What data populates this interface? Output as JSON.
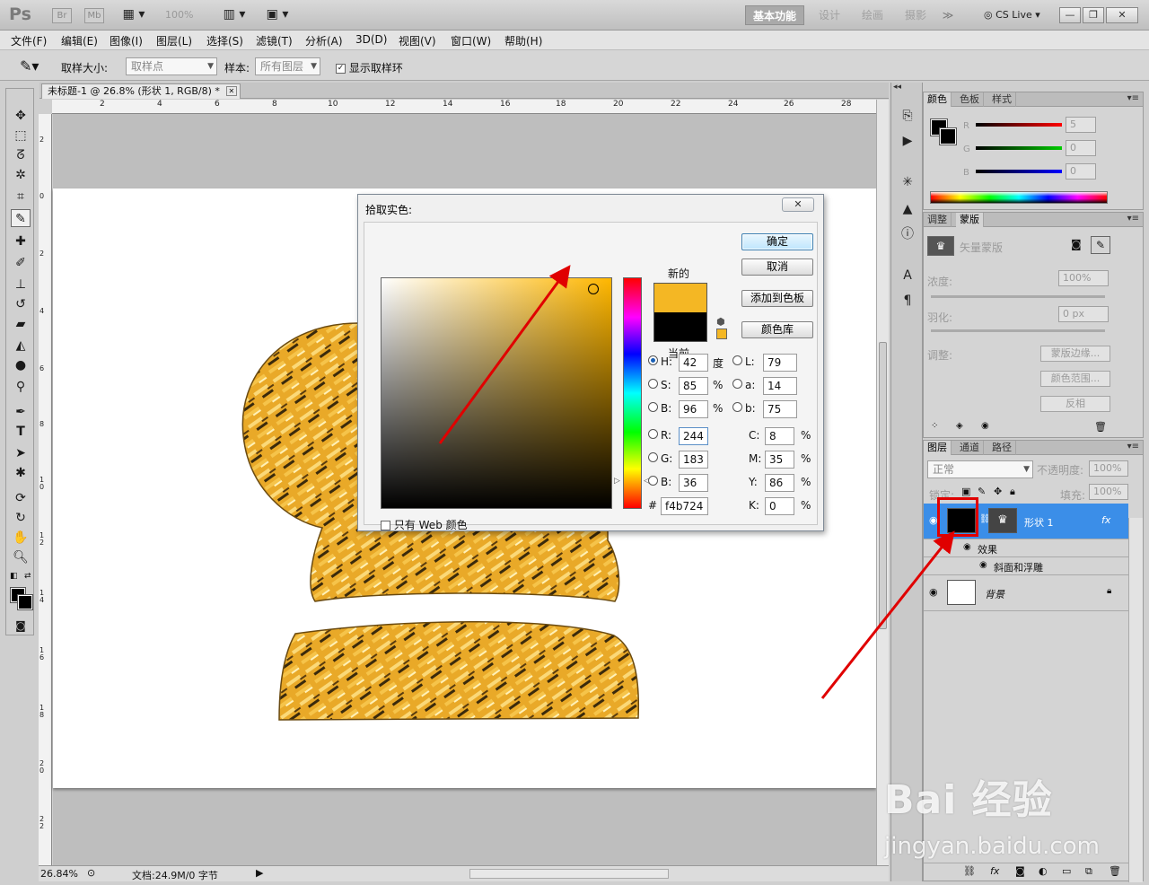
{
  "app": {
    "logo": "Ps",
    "bridge": "Br",
    "minibridge": "Mb",
    "zoom": "100%",
    "workspaces": [
      "基本功能",
      "设计",
      "绘画",
      "摄影"
    ],
    "more": "≫",
    "cslive": "CS Live",
    "window_buttons": [
      "—",
      "❐",
      "✕"
    ]
  },
  "menu": [
    "文件(F)",
    "编辑(E)",
    "图像(I)",
    "图层(L)",
    "选择(S)",
    "滤镜(T)",
    "分析(A)",
    "3D(D)",
    "视图(V)",
    "窗口(W)",
    "帮助(H)"
  ],
  "options": {
    "sample_size_label": "取样大小:",
    "sample_size_value": "取样点",
    "sample_label": "样本:",
    "sample_value": "所有图层",
    "show_ring_label": "显示取样环",
    "show_ring_checked": "✓"
  },
  "document": {
    "tab_title": "未标题-1 @ 26.8% (形状 1, RGB/8) *",
    "ruler_top": [
      "2",
      "4",
      "6",
      "8",
      "10",
      "12",
      "14",
      "16",
      "18",
      "20",
      "22",
      "24",
      "26",
      "28"
    ],
    "ruler_left": [
      "2",
      "0",
      "2",
      "4",
      "6",
      "8",
      "10",
      "12",
      "14",
      "16",
      "18",
      "20",
      "22"
    ],
    "zoom": "26.84%",
    "doc_info": "文档:24.9M/0 字节"
  },
  "picker": {
    "title": "拾取实色:",
    "close": "✕",
    "new_label": "新的",
    "current_label": "当前",
    "new_color": "#f4b724",
    "current_color": "#000000",
    "buttons": {
      "ok": "确定",
      "cancel": "取消",
      "add": "添加到色板",
      "library": "颜色库"
    },
    "hsb": {
      "h_label": "H:",
      "h": "42",
      "h_unit": "度",
      "s_label": "S:",
      "s": "85",
      "s_unit": "%",
      "b_label": "B:",
      "b": "96",
      "b_unit": "%"
    },
    "lab": {
      "l_label": "L:",
      "l": "79",
      "a_label": "a:",
      "a": "14",
      "b_label": "b:",
      "b": "75"
    },
    "rgb": {
      "r_label": "R:",
      "r": "244",
      "g_label": "G:",
      "g": "183",
      "b_label": "B:",
      "b": "36"
    },
    "cmyk": {
      "c_label": "C:",
      "c": "8",
      "m_label": "M:",
      "m": "35",
      "y_label": "Y:",
      "y": "86",
      "k_label": "K:",
      "k": "0",
      "unit": "%"
    },
    "hex_label": "#",
    "hex": "f4b724",
    "web_only": "只有 Web 颜色"
  },
  "color_panel": {
    "tabs": [
      "颜色",
      "色板",
      "样式"
    ],
    "r_label": "R",
    "g_label": "G",
    "b_label": "B",
    "r": "5",
    "g": "0",
    "b": "0"
  },
  "mask_panel": {
    "tabs": [
      "调整",
      "蒙版"
    ],
    "vector_mask": "矢量蒙版",
    "density_label": "浓度:",
    "density": "100%",
    "feather_label": "羽化:",
    "feather": "0 px",
    "adjust_label": "调整:",
    "btn_edge": "蒙版边缘...",
    "btn_range": "颜色范围...",
    "btn_invert": "反相"
  },
  "layers_panel": {
    "tabs": [
      "图层",
      "通道",
      "路径"
    ],
    "blend_mode": "正常",
    "opacity_label": "不透明度:",
    "opacity": "100%",
    "lock_label": "锁定:",
    "fill_label": "填充:",
    "fill": "100%",
    "layers": [
      {
        "name": "形状 1",
        "fx": "fx"
      },
      {
        "name": "效果"
      },
      {
        "name": "斜面和浮雕"
      },
      {
        "name": "背景"
      }
    ]
  },
  "watermark": {
    "brand": "Bai 经验",
    "url": "jingyan.baidu.com"
  },
  "colors": {
    "gold": "#f4b724",
    "accent_red": "#e00000",
    "selection_blue": "#3b8ee8"
  }
}
